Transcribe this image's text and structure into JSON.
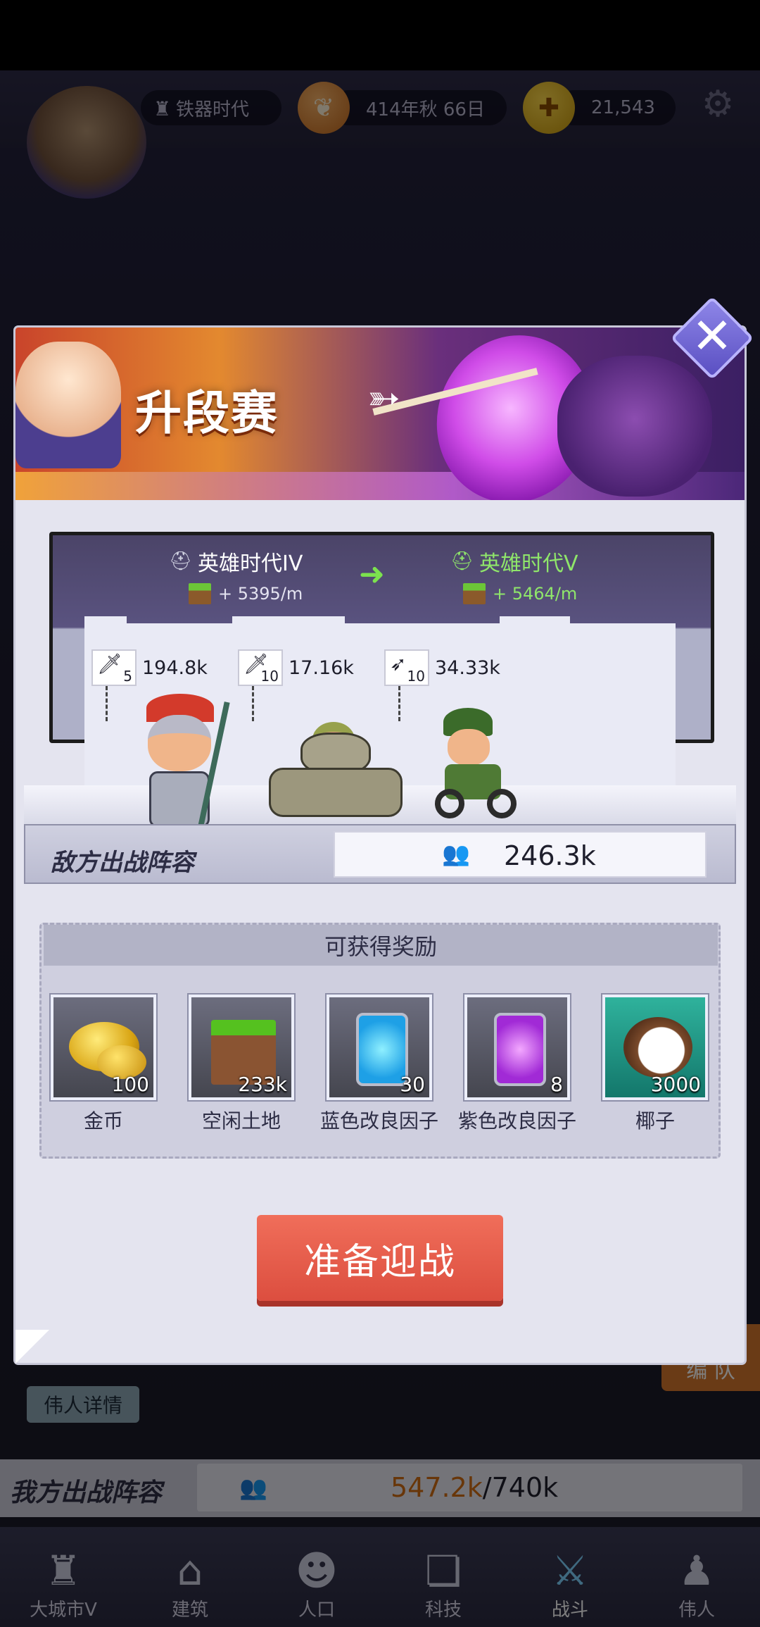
{
  "hud": {
    "era": "铁器时代",
    "date": "414年秋 66日",
    "coins": "21,543"
  },
  "modal": {
    "title": "升段赛",
    "rank_from": "英雄时代IV",
    "rank_to": "英雄时代V",
    "income_from": "+ 5395/m",
    "income_to": "+ 5464/m",
    "enemy_units": [
      {
        "count": "5",
        "power": "194.8k",
        "icon": "sword-icon"
      },
      {
        "count": "10",
        "power": "17.16k",
        "icon": "sword-icon"
      },
      {
        "count": "10",
        "power": "34.33k",
        "icon": "crossbow-icon"
      }
    ],
    "enemy_lineup_label": "敌方出战阵容",
    "enemy_power": "246.3k",
    "rewards_title": "可获得奖励",
    "rewards": [
      {
        "name": "金币",
        "qty": "100",
        "icon": "gold-coin-icon"
      },
      {
        "name": "空闲土地",
        "qty": "233k",
        "icon": "dirt-block-icon"
      },
      {
        "name": "蓝色改良因子",
        "qty": "30",
        "icon": "blue-jar-icon"
      },
      {
        "name": "紫色改良因子",
        "qty": "8",
        "icon": "purple-jar-icon"
      },
      {
        "name": "椰子",
        "qty": "3000",
        "icon": "coconut-icon"
      }
    ],
    "ready_button": "准备迎战"
  },
  "background": {
    "hero_detail_button": "伟人详情",
    "formation_button": "编 队",
    "my_lineup_label": "我方出战阵容",
    "my_power_current": "547.2k",
    "my_power_max": "/740k"
  },
  "nav": [
    {
      "label": "大城市V",
      "icon": "castle-icon"
    },
    {
      "label": "建筑",
      "icon": "house-icon"
    },
    {
      "label": "人口",
      "icon": "person-icon"
    },
    {
      "label": "科技",
      "icon": "book-icon"
    },
    {
      "label": "战斗",
      "icon": "swords-icon",
      "active": true
    },
    {
      "label": "伟人",
      "icon": "bust-icon"
    }
  ],
  "colors": {
    "accent_green": "#8fe66a",
    "ready_red": "#dc4e3f",
    "power_orange": "#d06d12"
  }
}
